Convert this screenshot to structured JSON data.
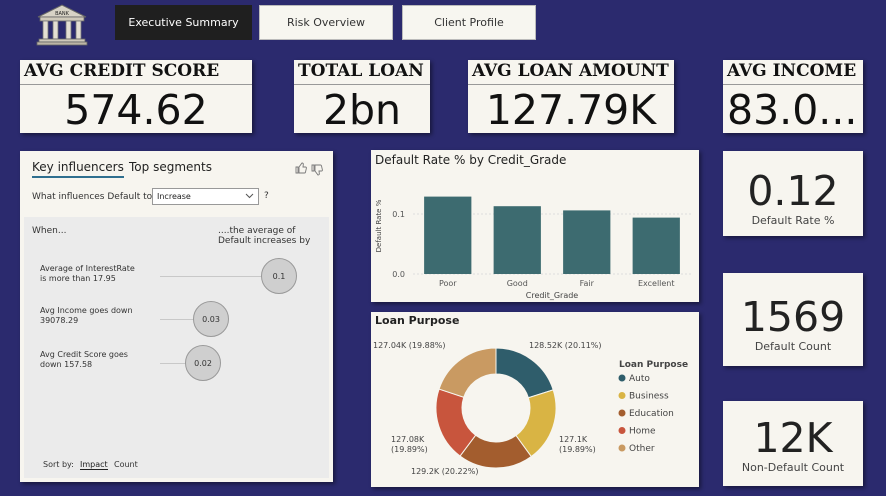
{
  "nav": {
    "logo_text": "BANK",
    "tabs": [
      "Executive Summary",
      "Risk Overview",
      "Client Profile"
    ]
  },
  "kpis": {
    "avg_credit_score": {
      "label": "AVG CREDIT SCORE",
      "value": "574.62"
    },
    "total_loan": {
      "label": "TOTAL LOAN",
      "value": "2bn"
    },
    "avg_loan_amount": {
      "label": "AVG LOAN AMOUNT",
      "value": "127.79K"
    },
    "avg_income": {
      "label": "AVG INCOME",
      "value": "83.0..."
    }
  },
  "cards": {
    "default_rate": {
      "value": "0.12",
      "label": "Default Rate %"
    },
    "default_count": {
      "value": "1569",
      "label": "Default Count"
    },
    "non_default_count": {
      "value": "12K",
      "label": "Non-Default Count"
    }
  },
  "influencers": {
    "tab_key": "Key influencers",
    "tab_segments": "Top segments",
    "question_prefix": "What influences Default to",
    "dropdown_value": "Increase",
    "question_suffix": "?",
    "col_when": "When...",
    "col_avg_line1": "....the average of",
    "col_avg_line2": "Default increases by",
    "rows": [
      {
        "line1": "Average of InterestRate",
        "line2": "is more than 17.95",
        "value": "0.1"
      },
      {
        "line1": "Avg Income goes down",
        "line2": "39078.29",
        "value": "0.03"
      },
      {
        "line1": "Avg Credit Score goes",
        "line2": "down 157.58",
        "value": "0.02"
      }
    ],
    "sort_by": "Sort by:",
    "sort_impact": "Impact",
    "sort_count": "Count"
  },
  "chart_data": [
    {
      "type": "bar",
      "title": "Default Rate % by Credit_Grade",
      "xlabel": "Credit_Grade",
      "ylabel": "Default Rate %",
      "categories": [
        "Poor",
        "Good",
        "Fair",
        "Excellent"
      ],
      "values": [
        0.129,
        0.113,
        0.106,
        0.094
      ],
      "yticks": [
        "0.1",
        "0.0"
      ],
      "ytick_values": [
        0.1,
        0.0
      ],
      "ylim": [
        0,
        0.16
      ],
      "color": "#3d6b70",
      "grid": true
    },
    {
      "type": "pie",
      "title": "Loan Purpose",
      "legend_title": "Loan Purpose",
      "legend_position": "right",
      "donut": true,
      "categories": [
        "Auto",
        "Business",
        "Education",
        "Home",
        "Other"
      ],
      "values": [
        128.52,
        127.1,
        129.2,
        127.08,
        127.04
      ],
      "labels": [
        "128.52K (20.11%)",
        "127.1K (19.89%)",
        "129.2K (20.22%)",
        "127.08K (19.89%)",
        "127.04K (19.88%)"
      ],
      "colors": [
        "#2f5d6b",
        "#d9b444",
        "#a35d2e",
        "#c8553d",
        "#c99a62"
      ]
    }
  ]
}
